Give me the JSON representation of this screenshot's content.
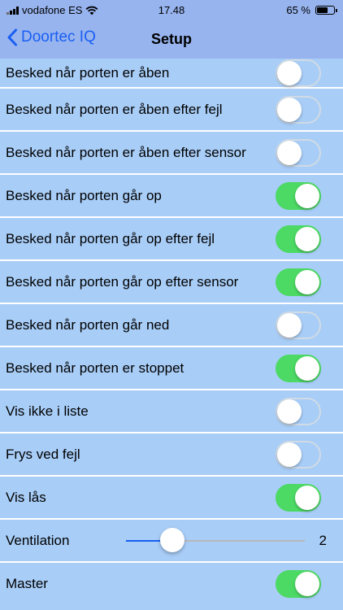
{
  "status_bar": {
    "carrier": "vodafone ES",
    "time": "17.48",
    "battery_percent": "65 %",
    "battery_level": 0.65,
    "icons": [
      "signal-icon",
      "wifi-icon",
      "battery-icon"
    ]
  },
  "nav": {
    "back_label": "Doortec IQ",
    "title": "Setup",
    "accent_color": "#1a5ff2"
  },
  "rows": [
    {
      "label": "Besked når porten er åben",
      "type": "toggle",
      "on": false
    },
    {
      "label": "Besked når porten er åben efter fejl",
      "type": "toggle",
      "on": false
    },
    {
      "label": "Besked når porten er åben efter sensor",
      "type": "toggle",
      "on": false
    },
    {
      "label": "Besked når porten går op",
      "type": "toggle",
      "on": true
    },
    {
      "label": "Besked når porten går op efter fejl",
      "type": "toggle",
      "on": true
    },
    {
      "label": "Besked når porten går op efter sensor",
      "type": "toggle",
      "on": true
    },
    {
      "label": "Besked når porten går ned",
      "type": "toggle",
      "on": false
    },
    {
      "label": "Besked når porten er stoppet",
      "type": "toggle",
      "on": true
    },
    {
      "label": "Vis ikke i liste",
      "type": "toggle",
      "on": false
    },
    {
      "label": "Frys ved fejl",
      "type": "toggle",
      "on": false
    },
    {
      "label": "Vis lås",
      "type": "toggle",
      "on": true
    },
    {
      "label": "Ventilation",
      "type": "slider",
      "value": "2",
      "fraction": 0.26
    },
    {
      "label": "Master",
      "type": "toggle",
      "on": true
    }
  ],
  "colors": {
    "background": "#a8cdf7",
    "bar": "#97b4ef",
    "toggle_on": "#4cd964"
  }
}
